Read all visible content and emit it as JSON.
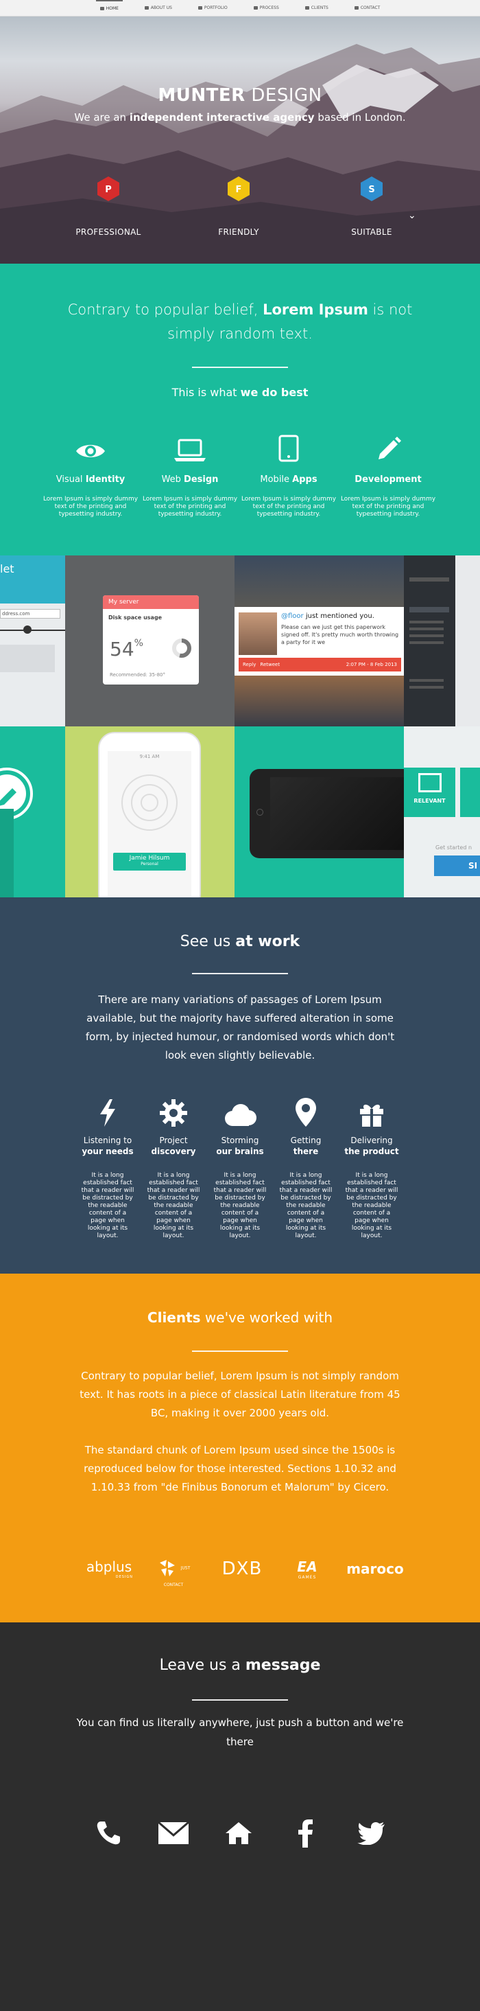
{
  "nav": {
    "items": [
      {
        "label": "HOME",
        "icon": "home-icon"
      },
      {
        "label": "ABOUT US",
        "icon": "user-icon"
      },
      {
        "label": "PORTFOLIO",
        "icon": "portfolio-icon"
      },
      {
        "label": "PROCESS",
        "icon": "process-icon"
      },
      {
        "label": "CLIENTS",
        "icon": "heart-icon"
      },
      {
        "label": "CONTACT",
        "icon": "mail-icon"
      }
    ]
  },
  "hero": {
    "title_bold": "MUNTER",
    "title_rest": " DESIGN",
    "subtitle_pre": "We are an ",
    "subtitle_bold": "independent interactive agency",
    "subtitle_post": " based in London.",
    "badges": [
      {
        "letter": "P",
        "label": "PROFESSIONAL",
        "color": "#d62c2c"
      },
      {
        "letter": "F",
        "label": "FRIENDLY",
        "color": "#f1c40f"
      },
      {
        "letter": "S",
        "label": "SUITABLE",
        "color": "#2f8fd0"
      }
    ]
  },
  "intro": {
    "heading_pre": "Contrary to popular belief, ",
    "heading_bold": "Lorem Ipsum",
    "heading_post": " is not simply random text.",
    "sub_pre": "This is what ",
    "sub_bold": "we do best",
    "services": [
      {
        "light": "Visual ",
        "bold": "Identity",
        "icon": "eye-icon",
        "desc": "Lorem Ipsum is simply dummy text of the printing and typesetting industry."
      },
      {
        "light": "Web ",
        "bold": "Design",
        "icon": "laptop-icon",
        "desc": "Lorem Ipsum is simply dummy text of the printing and typesetting industry."
      },
      {
        "light": "Mobile ",
        "bold": "Apps",
        "icon": "tablet-icon",
        "desc": "Lorem Ipsum is simply dummy text of the printing and typesetting industry."
      },
      {
        "light": "",
        "bold": "Development",
        "icon": "pencil-icon",
        "desc": "Lorem Ipsum is simply dummy text of the printing and typesetting industry."
      }
    ]
  },
  "portfolio": {
    "tile1_text": "let",
    "tile1_url": "ddress.com",
    "widget_title": "My server",
    "widget_row": "Disk space usage",
    "widget_value": "54",
    "widget_unit": "%",
    "widget_footer": "Recommended: 35-80°",
    "tweet_user": "@floor",
    "tweet_head": " just mentioned you.",
    "tweet_body": "Please can we just get this paperwork signed off. It's pretty much worth throwing a party for it we",
    "tweet_btn1": "Reply",
    "tweet_btn2": "Retweet",
    "tweet_time": "2:07 PM - 8 Feb 2013",
    "phone_time": "9:41 AM",
    "phone_name": "Jamie Hilsum",
    "phone_sub": "Personal",
    "relevant_label": "RELEVANT",
    "get_started": "Get started n",
    "si_btn": "SI"
  },
  "work": {
    "heading_pre": "See us ",
    "heading_bold": "at work",
    "text": "There are many variations of passages of Lorem Ipsum available, but the majority have suffered alteration in some form, by injected humour, or randomised words which don't look even slightly believable.",
    "steps": [
      {
        "t1": "Listening to",
        "t2": "your needs",
        "icon": "bolt-icon",
        "desc": "It is a long established fact that a reader will be distracted by the readable content of a page when looking at its layout."
      },
      {
        "t1": "Project",
        "t2": "discovery",
        "icon": "gear-icon",
        "desc": "It is a long established fact that a reader will be distracted by the readable content of a page when looking at its layout."
      },
      {
        "t1": "Storming",
        "t2": "our brains",
        "icon": "cloud-icon",
        "desc": "It is a long established fact that a reader will be distracted by the readable content of a page when looking at its layout."
      },
      {
        "t1": "Getting",
        "t2": "there",
        "icon": "map-marker-icon",
        "desc": "It is a long established fact that a reader will be distracted by the readable content of a page when looking at its layout."
      },
      {
        "t1": "Delivering",
        "t2": "the product",
        "icon": "gift-icon",
        "desc": "It is a long established fact that a reader will be distracted by the readable content of a page when looking at its layout."
      }
    ]
  },
  "clients": {
    "heading_bold": "Clients",
    "heading_rest": " we've worked with",
    "p1": "Contrary to popular belief, Lorem Ipsum is not simply random text. It has roots in a piece of classical Latin literature from 45 BC, making it over 2000 years old.",
    "p2": "The standard chunk of Lorem Ipsum used since the 1500s is reproduced below for those interested. Sections 1.10.32 and 1.10.33 from \"de Finibus Bonorum et Malorum\" by Cicero.",
    "logos": [
      {
        "text": "abplus",
        "sub": "DESIGN"
      },
      {
        "text": "",
        "sub": "JUST CONTACT"
      },
      {
        "text": "DXB",
        "sub": ""
      },
      {
        "text": "EA",
        "sub": "GAMES"
      },
      {
        "text": "maroco",
        "sub": ""
      }
    ]
  },
  "contact": {
    "heading_pre": "Leave us a ",
    "heading_bold": "message",
    "text": "You can find us literally anywhere, just push a button and we're there",
    "buttons": [
      "phone-icon",
      "envelope-icon",
      "home-icon",
      "facebook-icon",
      "twitter-icon"
    ]
  }
}
